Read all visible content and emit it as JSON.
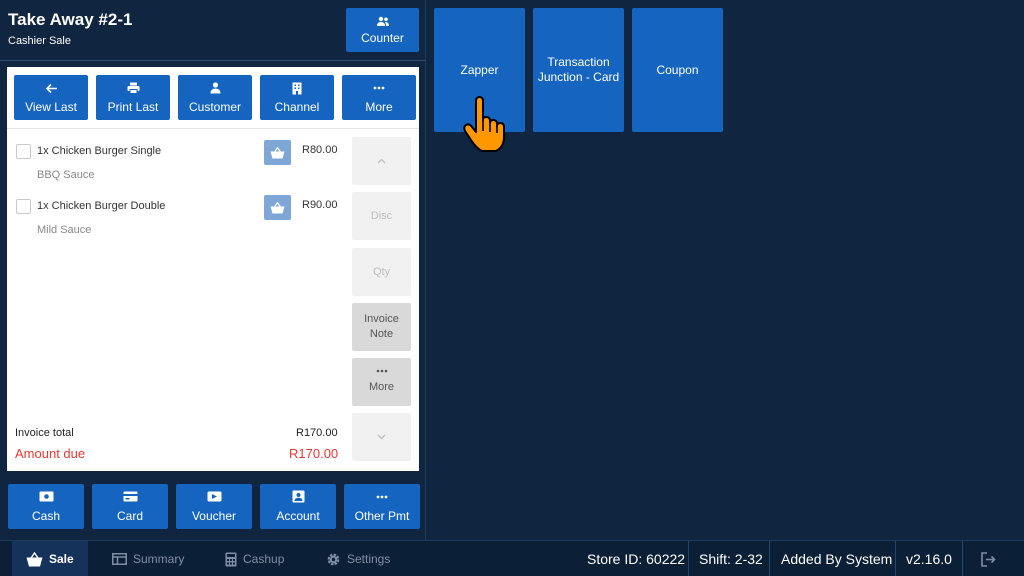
{
  "header": {
    "title": "Take Away #2-1",
    "subtitle": "Cashier Sale",
    "counter_label": "Counter"
  },
  "toolbar": {
    "view_last": "View Last",
    "print_last": "Print Last",
    "customer": "Customer",
    "channel": "Channel",
    "more": "More"
  },
  "order": {
    "items": [
      {
        "name": "1x Chicken Burger Single",
        "modifier": "BBQ Sauce",
        "price": "R80.00"
      },
      {
        "name": "1x Chicken Burger Double",
        "modifier": "Mild Sauce",
        "price": "R90.00"
      }
    ],
    "side": {
      "disc": "Disc",
      "qty": "Qty",
      "invoice_note_1": "Invoice",
      "invoice_note_2": "Note",
      "more": "More"
    },
    "invoice_total_label": "Invoice total",
    "invoice_total": "R170.00",
    "amount_due_label": "Amount due",
    "amount_due": "R170.00"
  },
  "payments": {
    "cash": "Cash",
    "card": "Card",
    "voucher": "Voucher",
    "account": "Account",
    "other": "Other Pmt"
  },
  "tiles": {
    "zapper": "Zapper",
    "tj_line1": "Transaction",
    "tj_line2": "Junction - Card",
    "coupon": "Coupon"
  },
  "footer": {
    "nav": {
      "sale": "Sale",
      "summary": "Summary",
      "cashup": "Cashup",
      "settings": "Settings"
    },
    "store": "Store ID: 60222",
    "shift": "Shift: 2-32",
    "added_by": "Added By System",
    "version": "v2.16.0"
  },
  "colors": {
    "background": "#0f2540",
    "button": "#1565c0",
    "amount_due": "#e53935",
    "basket": "#7ea7d8"
  },
  "icons": [
    "users-icon",
    "arrow-left-icon",
    "printer-icon",
    "person-icon",
    "building-icon",
    "ellipsis-icon",
    "basket-icon",
    "chevron-up-icon",
    "chevron-down-icon",
    "cash-icon",
    "credit-card-icon",
    "voucher-icon",
    "account-icon",
    "hand-pointer-icon",
    "cart-icon",
    "table-icon",
    "calculator-icon",
    "gear-icon",
    "logout-icon"
  ]
}
